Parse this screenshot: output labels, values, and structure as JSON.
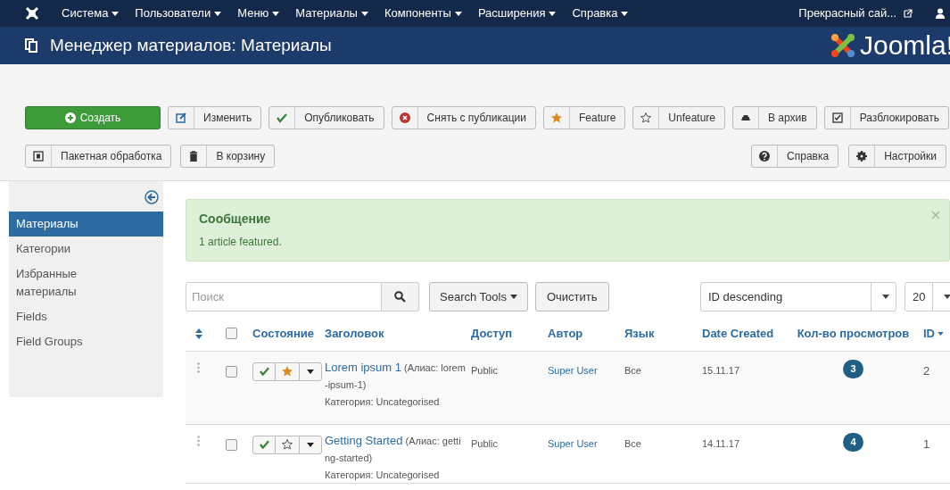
{
  "top_menu": {
    "items": [
      {
        "label": "Система"
      },
      {
        "label": "Пользователи"
      },
      {
        "label": "Меню"
      },
      {
        "label": "Материалы"
      },
      {
        "label": "Компоненты"
      },
      {
        "label": "Расширения"
      },
      {
        "label": "Справка"
      }
    ],
    "site_link": "Прекрасный сай..."
  },
  "header": {
    "title": "Менеджер материалов: Материалы",
    "logo_text": "Joomla!"
  },
  "toolbar": {
    "row_1": [
      {
        "label": "Создать",
        "kind": "primary"
      },
      {
        "label": "Изменить",
        "kind": "default"
      },
      {
        "label": "Опубликовать",
        "kind": "default"
      },
      {
        "label": "Снять с публикации",
        "kind": "default"
      },
      {
        "label": "Feature",
        "kind": "default"
      },
      {
        "label": "Unfeature",
        "kind": "default"
      },
      {
        "label": "В архив",
        "kind": "default"
      },
      {
        "label": "Разблокировать",
        "kind": "default"
      }
    ],
    "row_2_left": [
      {
        "label": "Пакетная обработка",
        "kind": "default"
      },
      {
        "label": "В корзину",
        "kind": "default"
      }
    ],
    "row_2_right": [
      {
        "label": "Справка",
        "kind": "default"
      },
      {
        "label": "Настройки",
        "kind": "default"
      }
    ]
  },
  "sidebar": {
    "items": [
      {
        "label": "Материалы",
        "selected": true
      },
      {
        "label": "Категории",
        "selected": false
      },
      {
        "label": "Избранные материалы",
        "selected": false
      },
      {
        "label": "Fields",
        "selected": false
      },
      {
        "label": "Field Groups",
        "selected": false
      }
    ]
  },
  "message": {
    "heading": "Сообщение",
    "text": "1 article featured."
  },
  "filters": {
    "search": {
      "placeholder": "Поиск"
    },
    "search_tools": "Search Tools",
    "clear": "Очистить",
    "ordering": "ID descending",
    "limit": "20"
  },
  "table": {
    "select_all_checked": false,
    "columns": [
      "Состояние",
      "Заголовок",
      "Доступ",
      "Автор",
      "Язык",
      "Date Created",
      "Кол-во просмотров",
      "ID"
    ],
    "rows": [
      {
        "checked": false,
        "published": true,
        "featured": true,
        "title": "Lorem ipsum 1",
        "alias": "(Алиас: lorem-ipsum-1)",
        "category": "Категория: Uncategorised",
        "access": "Public",
        "author": "Super User",
        "language": "Все",
        "date": "15.11.17",
        "views": "3",
        "id": "2"
      },
      {
        "checked": false,
        "published": true,
        "featured": false,
        "title": "Getting Started",
        "alias": "(Алиас: getting-started)",
        "category": "Категория: Uncategorised",
        "access": "Public",
        "author": "Super User",
        "language": "Все",
        "date": "14.11.17",
        "views": "4",
        "id": "1"
      }
    ]
  }
}
